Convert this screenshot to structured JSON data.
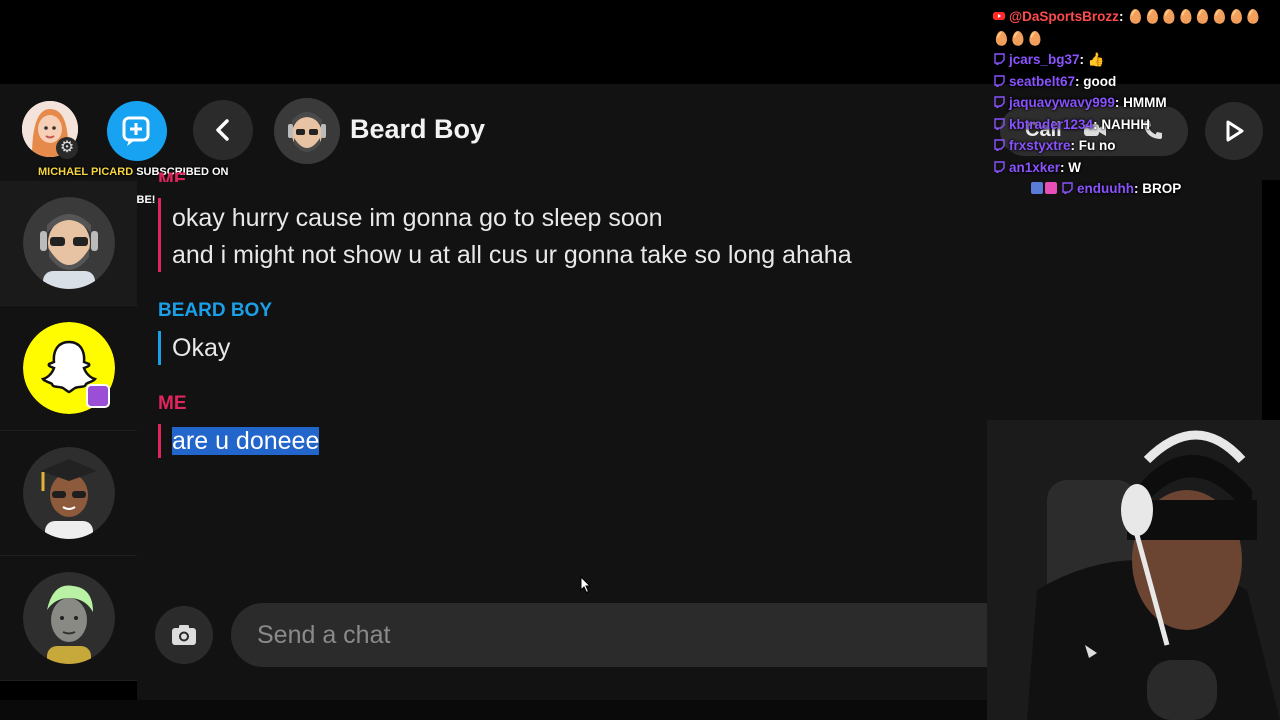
{
  "header": {
    "contact_name": "Beard Boy",
    "call_label": "Call",
    "subscriber_name": "MICHAEL PICARD",
    "subscriber_text": "SUBSCRIBED ON",
    "subscriber_platform": "YOUTUBE!"
  },
  "conversation": {
    "prev_sender_partial": "ME",
    "messages": [
      {
        "sender": "",
        "color": "#e0245e",
        "lines": [
          "okay hurry cause im gonna go to sleep soon",
          "and i might not show u at all cus ur gonna take so long ahaha"
        ]
      },
      {
        "sender": "BEARD BOY",
        "color": "#1aa0e8",
        "lines": [
          "Okay"
        ]
      },
      {
        "sender": "ME",
        "color": "#e0245e",
        "lines": [
          "are u doneee"
        ],
        "highlighted": true
      }
    ]
  },
  "composer": {
    "placeholder": "Send a chat"
  },
  "sidebar": {
    "items": [
      {
        "name": "beard-boy",
        "active": true
      },
      {
        "name": "team-snapchat",
        "active": false
      },
      {
        "name": "graduate-friend",
        "active": false
      },
      {
        "name": "green-hair-friend",
        "active": false
      }
    ]
  },
  "overlay_chat": [
    {
      "platform": "youtube",
      "user": "@DaSportsBrozz",
      "message": "🥚🥚🥚🥚🥚🥚🥚🥚"
    },
    {
      "platform": "",
      "user": "",
      "message": "🥚🥚🥚"
    },
    {
      "platform": "twitch",
      "user": "jcars_bg37",
      "message": "👍"
    },
    {
      "platform": "twitch",
      "user": "seatbelt67",
      "message": "good"
    },
    {
      "platform": "twitch",
      "user": "jaquavywavy999",
      "message": "HMMM"
    },
    {
      "platform": "twitch",
      "user": "kbtrader1234",
      "message": "NAHHH"
    },
    {
      "platform": "twitch",
      "user": "frxstyxtre",
      "message": "Fu no"
    },
    {
      "platform": "twitch",
      "user": "an1xker",
      "message": "W"
    },
    {
      "platform": "twitch",
      "user": "enduuhh",
      "message": "BROP"
    }
  ],
  "colors": {
    "me": "#e0245e",
    "friend": "#1aa0e8",
    "twitch": "#8a53ff",
    "youtube": "#ff4a4a",
    "selection": "#2266cc",
    "background": "#121212"
  }
}
